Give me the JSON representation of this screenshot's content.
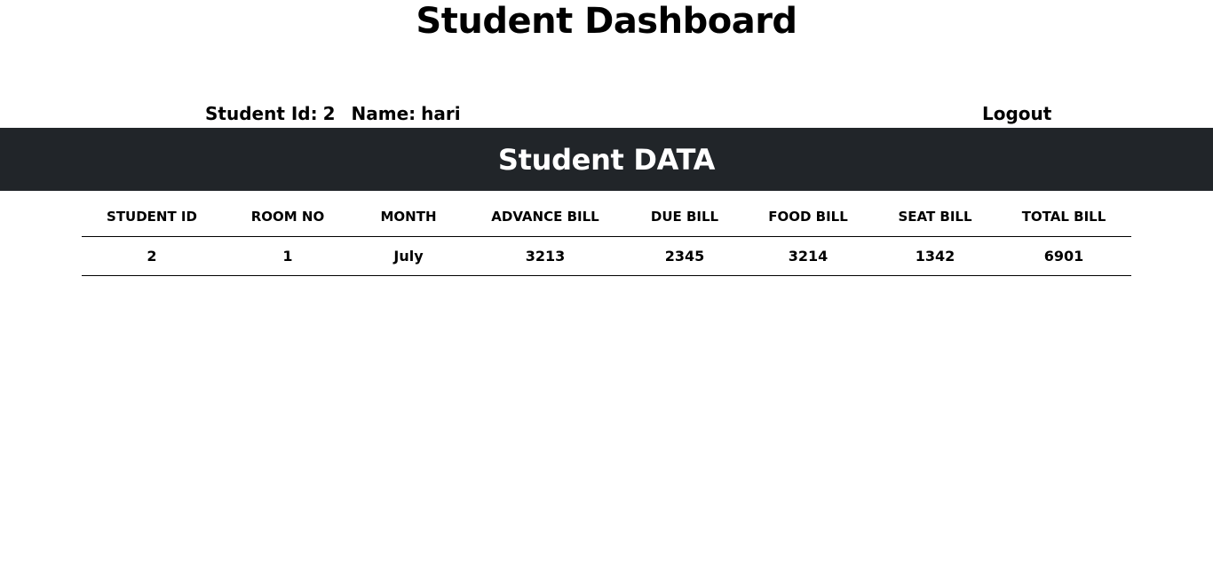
{
  "header": {
    "title": "Student Dashboard"
  },
  "student": {
    "id_label": "Student Id:",
    "id_value": "2",
    "name_label": "Name:",
    "name_value": "hari"
  },
  "nav": {
    "logout_label": "Logout"
  },
  "banner": {
    "title": "Student DATA"
  },
  "table": {
    "columns": [
      "STUDENT ID",
      "ROOM NO",
      "MONTH",
      "ADVANCE BILL",
      "DUE BILL",
      "FOOD BILL",
      "SEAT BILL",
      "TOTAL BILL"
    ],
    "rows": [
      [
        "2",
        "1",
        "July",
        "3213",
        "2345",
        "3214",
        "1342",
        "6901"
      ]
    ]
  }
}
